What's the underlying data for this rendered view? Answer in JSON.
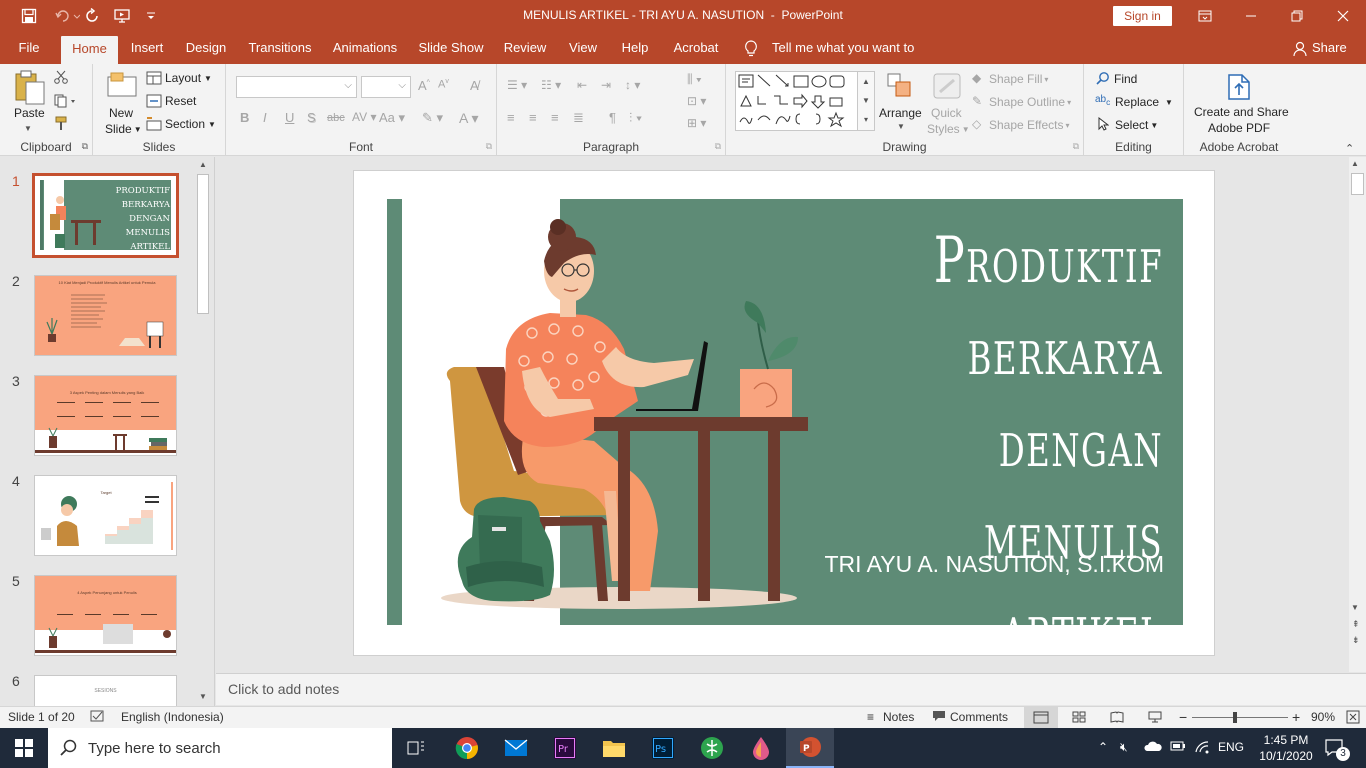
{
  "app": {
    "doc_title": "MENULIS ARTIKEL - TRI AYU A. NASUTION",
    "separator": "-",
    "app_name": "PowerPoint",
    "sign_in": "Sign in"
  },
  "tabs": [
    {
      "label": "File"
    },
    {
      "label": "Home"
    },
    {
      "label": "Insert"
    },
    {
      "label": "Design"
    },
    {
      "label": "Transitions"
    },
    {
      "label": "Animations"
    },
    {
      "label": "Slide Show"
    },
    {
      "label": "Review"
    },
    {
      "label": "View"
    },
    {
      "label": "Help"
    },
    {
      "label": "Acrobat"
    }
  ],
  "tell_me": "Tell me what you want to do",
  "share": "Share",
  "ribbon": {
    "clipboard": {
      "label": "Clipboard",
      "paste": "Paste"
    },
    "slides": {
      "label": "Slides",
      "new_slide_1": "New",
      "new_slide_2": "Slide",
      "layout": "Layout",
      "reset": "Reset",
      "section": "Section"
    },
    "font": {
      "label": "Font"
    },
    "paragraph": {
      "label": "Paragraph"
    },
    "drawing": {
      "label": "Drawing",
      "arrange": "Arrange",
      "quick_styles_1": "Quick",
      "quick_styles_2": "Styles",
      "shape_fill": "Shape Fill",
      "shape_outline": "Shape Outline",
      "shape_effects": "Shape Effects"
    },
    "editing": {
      "label": "Editing",
      "find": "Find",
      "replace": "Replace",
      "select": "Select"
    },
    "acrobat": {
      "label": "Adobe Acrobat",
      "create_1": "Create and Share",
      "create_2": "Adobe PDF"
    }
  },
  "thumbnails": [
    {
      "num": "1",
      "text": "PRODUKTIF BERKARYA DENGAN MENULIS ARTIKEL"
    },
    {
      "num": "2",
      "text": "10 Kiat Menjadi Produktif Menulis Artikel untuk Pemula"
    },
    {
      "num": "3",
      "text": "3 Aspek Penting dalam Menulis yang Baik"
    },
    {
      "num": "4",
      "text": "Target"
    },
    {
      "num": "5",
      "text": "4 Aspek Penunjang untuk Penulis"
    },
    {
      "num": "6",
      "text": "SESIONS"
    }
  ],
  "slide": {
    "title_lines": [
      "Produktif berkarya",
      "dengan menulis",
      "artikel"
    ],
    "subtitle": "TRI AYU A. NASUTION, S.I.KOM"
  },
  "notes_placeholder": "Click to add notes",
  "status": {
    "slide_info": "Slide 1 of 20",
    "language": "English (Indonesia)",
    "notes": "Notes",
    "comments": "Comments",
    "zoom": "90%"
  },
  "taskbar": {
    "search_placeholder": "Type here to search",
    "lang": "ENG",
    "time": "1:45 PM",
    "date": "10/1/2020",
    "notif_count": "3"
  },
  "colors": {
    "accent": "#b7472a",
    "slide_green": "#5e8b76",
    "slide_peach": "#f9a47f"
  }
}
